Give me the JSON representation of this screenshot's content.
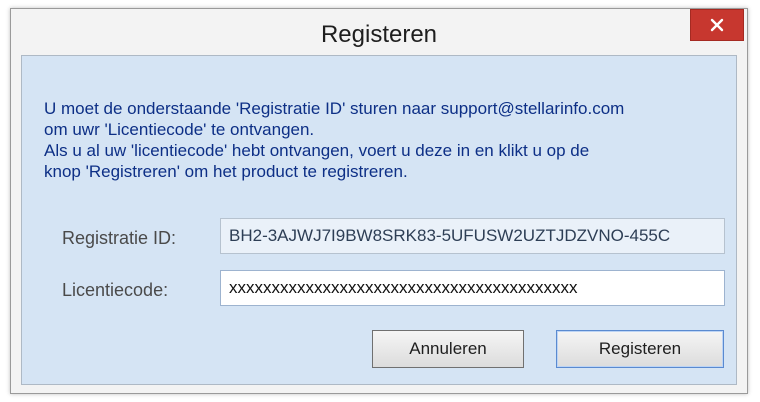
{
  "window": {
    "title": "Registeren",
    "close_glyph": "✕"
  },
  "instructions": {
    "line1": "U moet de onderstaande 'Registratie ID' sturen naar support@stellarinfo.com",
    "line2": "om uwr 'Licentiecode' te ontvangen.",
    "line3": "Als u al uw 'licentiecode' hebt ontvangen, voert u deze in en klikt u op de",
    "line4": "knop 'Registreren' om het product te registreren."
  },
  "fields": {
    "registration_id": {
      "label": "Registratie ID:",
      "value": "BH2-3AJWJ7I9BW8SRK83-5UFUSW2UZTJDZVNO-455C"
    },
    "license_code": {
      "label": "Licentiecode:",
      "value": "xxxxxxxxxxxxxxxxxxxxxxxxxxxxxxxxxxxxxxxxx"
    }
  },
  "buttons": {
    "cancel_label": "Annuleren",
    "register_label": "Registeren"
  },
  "colors": {
    "close_button": "#c7372f",
    "client_background": "#d5e4f4",
    "instruction_text": "#0d2f86"
  },
  "icons": {
    "close": "close-icon"
  }
}
